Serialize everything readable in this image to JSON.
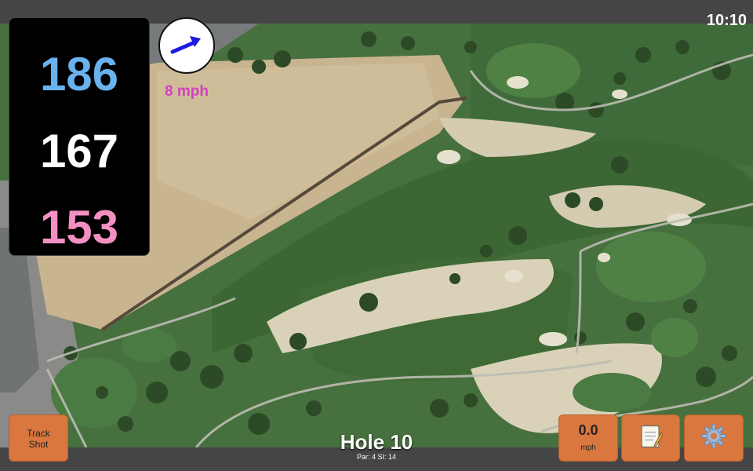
{
  "status": {
    "clock": "10:10"
  },
  "distances": {
    "back": "186",
    "center": "167",
    "front": "153"
  },
  "wind": {
    "speed_label": "8 mph",
    "icon": "wind-arrow-icon"
  },
  "buttons": {
    "track_shot": {
      "line1": "Track",
      "line2": "Shot"
    },
    "speed": {
      "value": "0.0",
      "unit": "mph"
    },
    "notes": {
      "icon": "notepad-icon"
    },
    "settings": {
      "icon": "gear-icon"
    }
  },
  "hole": {
    "title": "Hole 10",
    "info": "Par: 4    SI: 14"
  },
  "colors": {
    "back_distance": "#6ab2ee",
    "center_distance": "#ffffff",
    "front_distance": "#f48fc3",
    "wind_label": "#d43fc3",
    "button": "#d9773e"
  }
}
